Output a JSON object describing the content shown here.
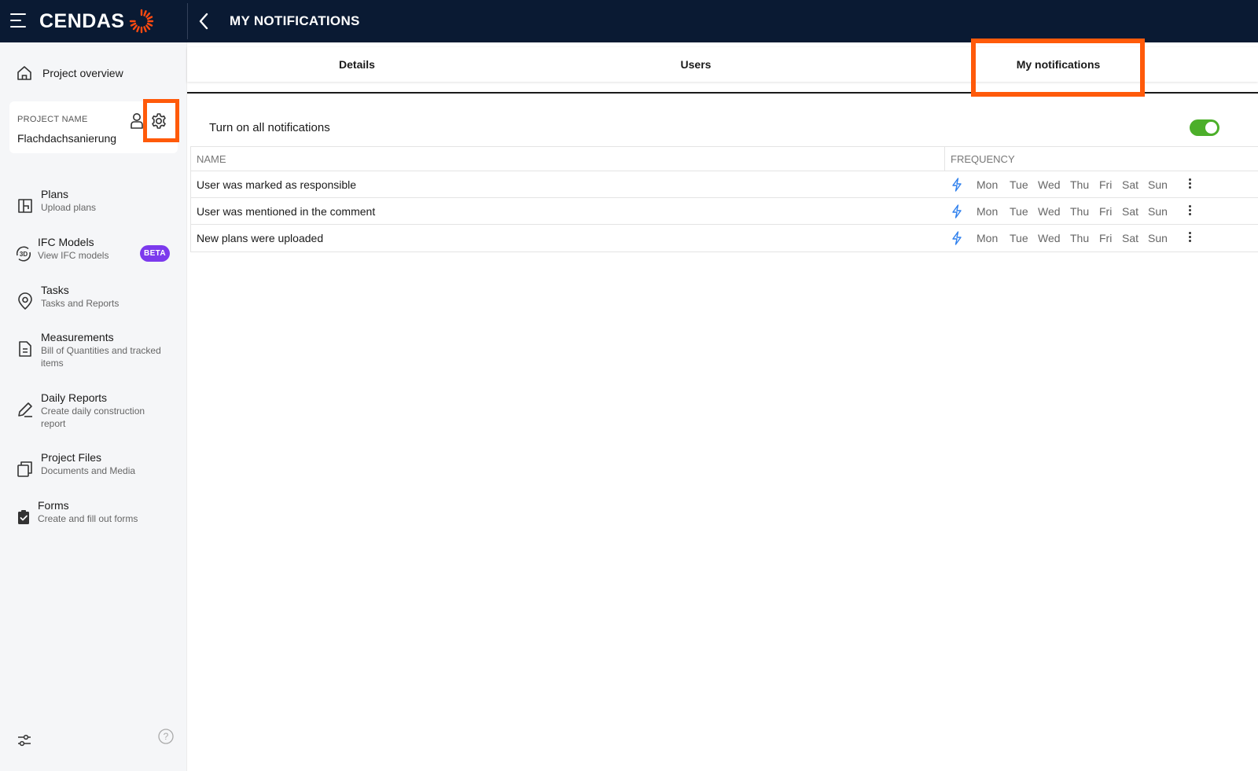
{
  "header": {
    "logo_text": "CENDAS",
    "title": "MY NOTIFICATIONS"
  },
  "sidebar": {
    "overview_label": "Project overview",
    "project": {
      "caption": "PROJECT NAME",
      "name": "Flachdachsanierung"
    },
    "items": [
      {
        "title": "Plans",
        "subtitle": "Upload plans",
        "icon": "plans-icon"
      },
      {
        "title": "IFC Models",
        "subtitle": "View IFC models",
        "icon": "3d-model-icon",
        "badge": "BETA"
      },
      {
        "title": "Tasks",
        "subtitle": "Tasks and Reports",
        "icon": "location-pin-icon"
      },
      {
        "title": "Measurements",
        "subtitle": "Bill of Quantities and tracked items",
        "icon": "document-icon"
      },
      {
        "title": "Daily Reports",
        "subtitle": "Create daily construction report",
        "icon": "pencil-icon"
      },
      {
        "title": "Project Files",
        "subtitle": "Documents and Media",
        "icon": "files-icon"
      },
      {
        "title": "Forms",
        "subtitle": "Create and fill out forms",
        "icon": "clipboard-check-icon"
      }
    ]
  },
  "tabs": [
    {
      "label": "Details",
      "active": false
    },
    {
      "label": "Users",
      "active": false
    },
    {
      "label": "My notifications",
      "active": true
    }
  ],
  "notifications": {
    "toggle_all_label": "Turn on all notifications",
    "toggle_all_on": true,
    "columns": {
      "name": "NAME",
      "frequency": "FREQUENCY"
    },
    "days": [
      "Mon",
      "Tue",
      "Wed",
      "Thu",
      "Fri",
      "Sat",
      "Sun"
    ],
    "rows": [
      {
        "name": "User was marked as responsible"
      },
      {
        "name": "User was mentioned in the comment"
      },
      {
        "name": "New plans were uploaded"
      }
    ]
  },
  "colors": {
    "topbar": "#0a1a33",
    "highlight": "#ff5a0a",
    "toggle_on": "#4caf2a",
    "beta_badge": "#7c3aed",
    "instant_icon": "#2f80ed"
  }
}
